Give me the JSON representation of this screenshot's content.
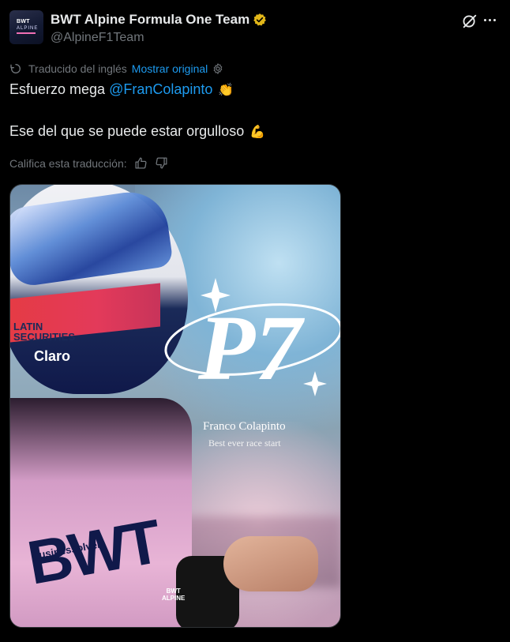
{
  "account": {
    "name": "BWT Alpine Formula One Team",
    "handle": "@AlpineF1Team",
    "avatar_text": "BWT",
    "avatar_sub": "ALPINE",
    "verified_color": "#e2b719"
  },
  "icons": [
    "grok-icon",
    "more-icon",
    "translate-icon",
    "settings-icon",
    "thumbs-up-icon",
    "thumbs-down-icon",
    "verified-badge-icon"
  ],
  "translation": {
    "label": "Traducido del inglés",
    "show_original": "Mostrar original"
  },
  "tweet": {
    "line1_text": "Esfuerzo mega",
    "mention": "@FranColapinto",
    "line1_emoji": "👏",
    "line2_text": "Ese del que se puede estar orgulloso",
    "line2_emoji": "💪"
  },
  "rating": {
    "label": "Califica esta traducción:"
  },
  "media": {
    "graphic_text": "P7",
    "caption_name": "Franco Colapinto",
    "caption_sub": "Best ever race start",
    "helmet_sponsor_1": "LATIN",
    "helmet_sponsor_2": "SECURITIES",
    "helmet_sponsor_3": "Claro",
    "suit_text": "BWT",
    "suit_sponsor": "businessolver",
    "corner_logo_1": "BWT",
    "corner_logo_2": "ALPINE"
  },
  "colors": {
    "background": "#000000",
    "text": "#e7e9ea",
    "muted": "#71767b",
    "link": "#1d9bf0"
  }
}
